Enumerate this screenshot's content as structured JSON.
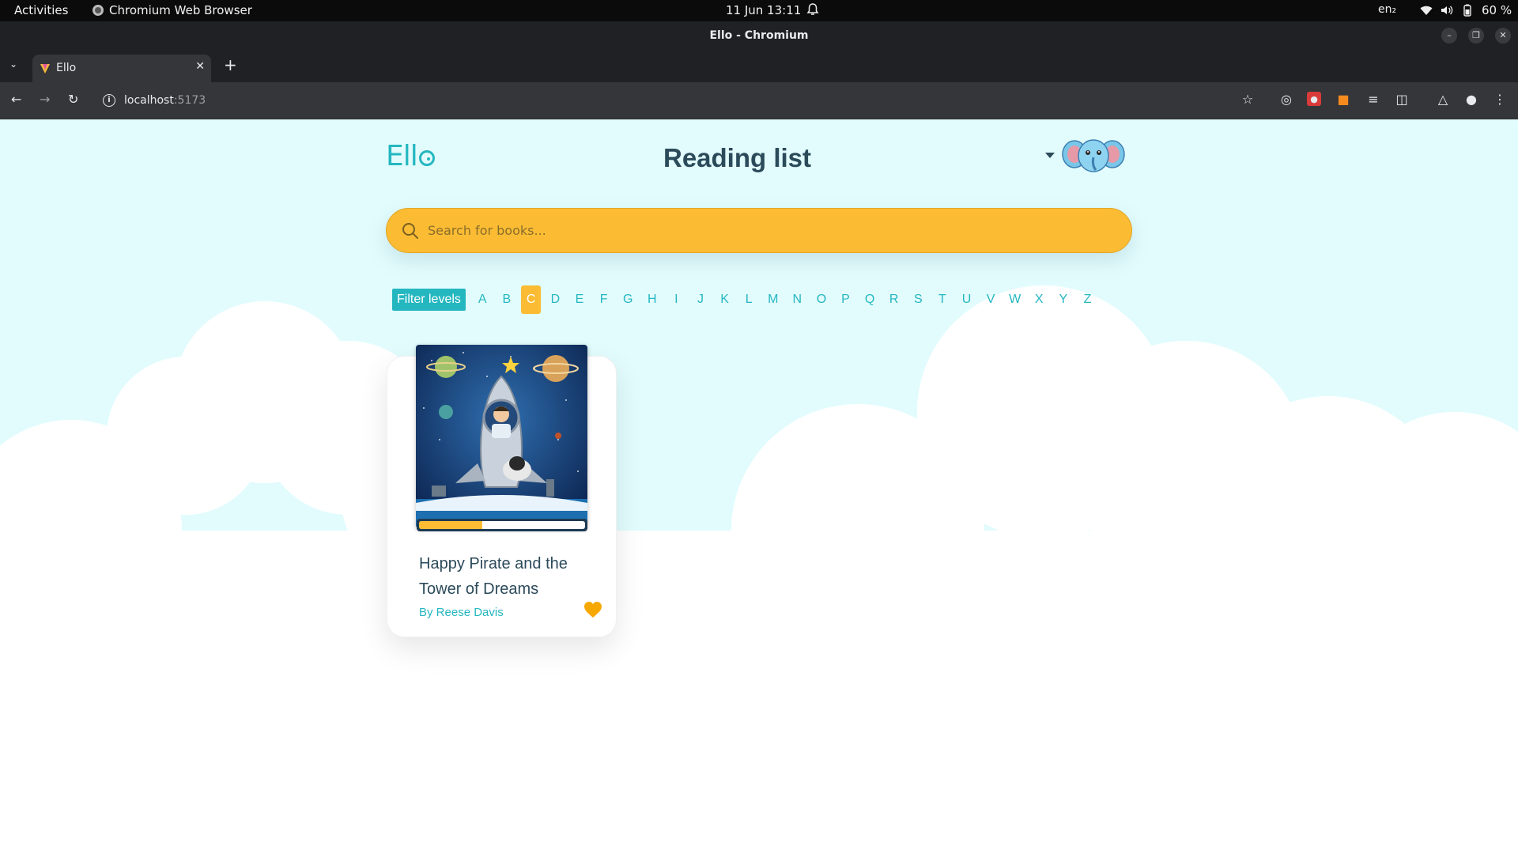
{
  "system_bar": {
    "activities": "Activities",
    "app_name": "Chromium Web Browser",
    "clock": "11 Jun  13:11",
    "language": "en₂",
    "battery": "60 %"
  },
  "window": {
    "title": "Ello - Chromium"
  },
  "tabs": [
    {
      "label": "Ello",
      "active": true
    }
  ],
  "address_bar": {
    "host": "localhost",
    "port": ":5173"
  },
  "page": {
    "logo": "Ell",
    "title": "Reading list",
    "search": {
      "placeholder": "Search for books..."
    },
    "filters": {
      "label": "Filter levels",
      "letters": [
        "A",
        "B",
        "C",
        "D",
        "E",
        "F",
        "G",
        "H",
        "I",
        "J",
        "K",
        "L",
        "M",
        "N",
        "O",
        "P",
        "Q",
        "R",
        "S",
        "T",
        "U",
        "V",
        "W",
        "X",
        "Y",
        "Z"
      ],
      "active": "C"
    },
    "books": [
      {
        "title": "Happy Pirate and the Tower of Dreams",
        "author": "By Reese Davis",
        "progress": 0.38,
        "favorite": true
      }
    ]
  },
  "colors": {
    "accent_teal": "#25b7c0",
    "accent_yellow": "#fbbc34",
    "page_bg": "#e2fcfd",
    "heading": "#2b4a5a"
  }
}
